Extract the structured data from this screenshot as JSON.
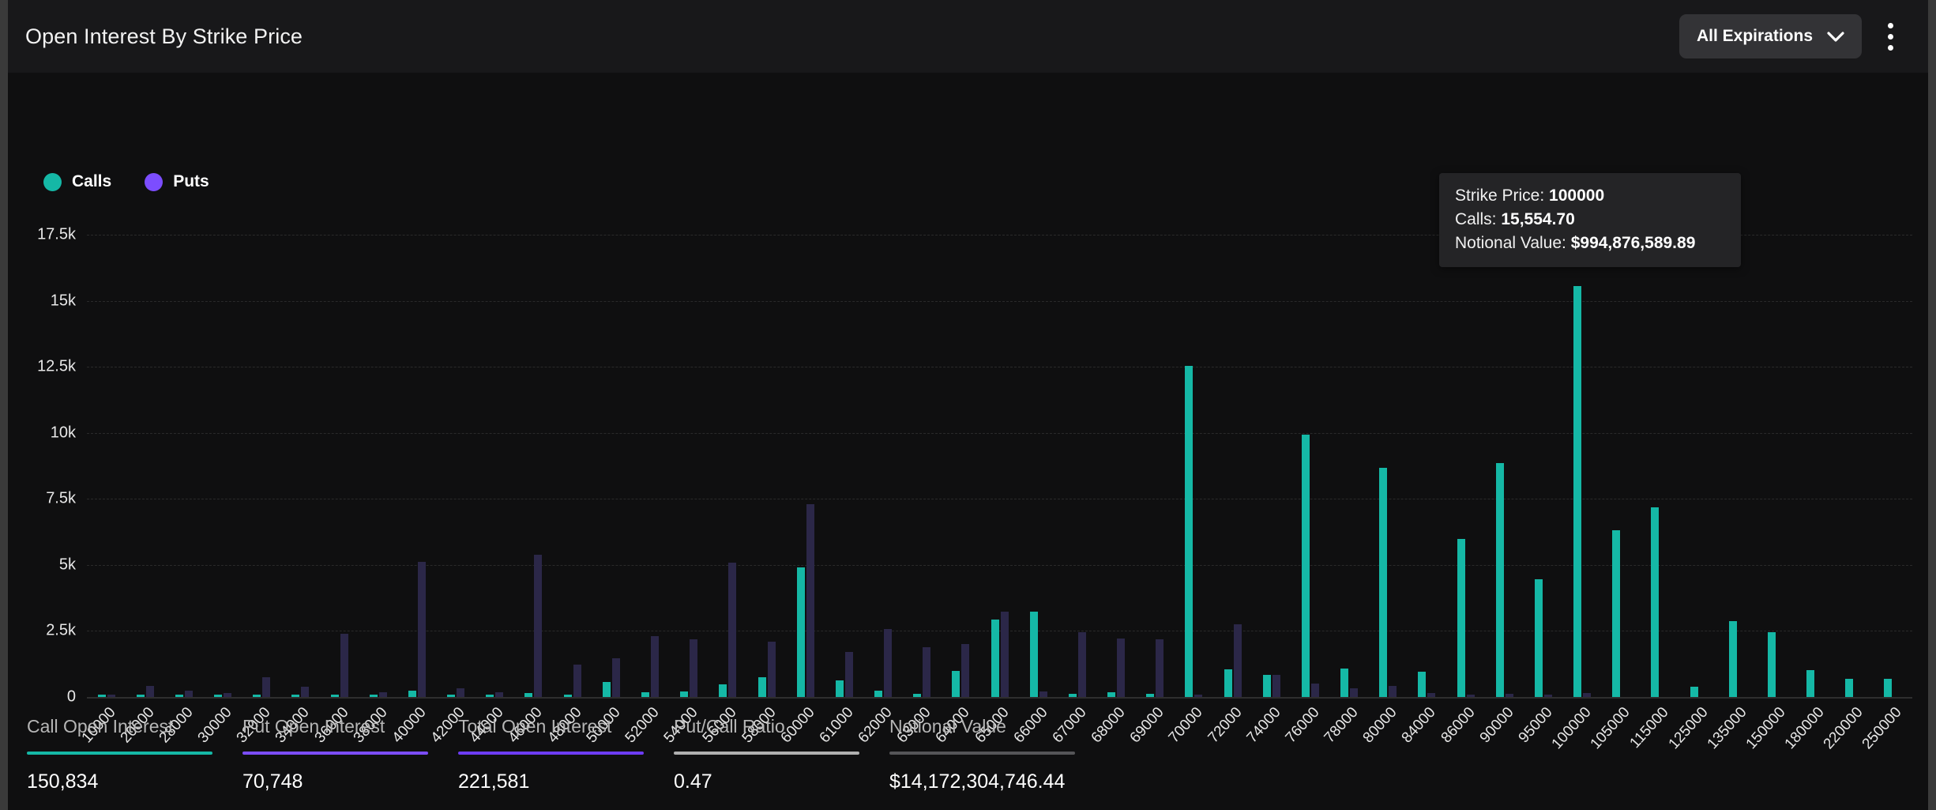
{
  "header": {
    "title": "Open Interest By Strike Price",
    "expirations_label": "All Expirations",
    "chevron_icon": "chevron-down-icon",
    "menu_icon": "kebab-menu-icon"
  },
  "legend": [
    {
      "label": "Calls",
      "color": "#15b8a6"
    },
    {
      "label": "Puts",
      "color": "#7c4dff"
    }
  ],
  "tooltip": {
    "strike_label": "Strike Price:",
    "strike_value": "100000",
    "calls_label": "Calls:",
    "calls_value": "15,554.70",
    "notional_label": "Notional Value:",
    "notional_value": "$994,876,589.89"
  },
  "stats": [
    {
      "label": "Call Open Interest",
      "value": "150,834",
      "color": "#15b8a6"
    },
    {
      "label": "Put Open Interest",
      "value": "70,748",
      "color": "#7c4dff"
    },
    {
      "label": "Total Open Interest",
      "value": "221,581",
      "color": "#6d3cf5"
    },
    {
      "label": "Put/Call Ratio",
      "value": "0.47",
      "color": "#b0b0b0"
    },
    {
      "label": "Notional Value",
      "value": "$14,172,304,746.44",
      "color": "#555558"
    }
  ],
  "chart_data": {
    "type": "bar",
    "title": "Open Interest By Strike Price",
    "xlabel": "",
    "ylabel": "",
    "ylim": [
      0,
      18400
    ],
    "grid": true,
    "legend_position": "top-left",
    "ytick_labels": [
      "17.5k",
      "15k",
      "12.5k",
      "10k",
      "7.5k",
      "5k",
      "2.5k",
      "0"
    ],
    "ytick_values": [
      17500,
      15000,
      12500,
      10000,
      7500,
      5000,
      2500,
      0
    ],
    "categories": [
      "10000",
      "20000",
      "28000",
      "30000",
      "32000",
      "34000",
      "36000",
      "38000",
      "40000",
      "42000",
      "44000",
      "46000",
      "48000",
      "50000",
      "52000",
      "54000",
      "56000",
      "58000",
      "60000",
      "61000",
      "62000",
      "63000",
      "64000",
      "65000",
      "66000",
      "67000",
      "68000",
      "69000",
      "70000",
      "72000",
      "74000",
      "76000",
      "78000",
      "80000",
      "84000",
      "86000",
      "90000",
      "95000",
      "100000",
      "105000",
      "115000",
      "125000",
      "135000",
      "150000",
      "180000",
      "220000",
      "250000"
    ],
    "series": [
      {
        "name": "Calls",
        "color": "#15b8a6",
        "values": [
          60,
          90,
          100,
          40,
          70,
          30,
          60,
          70,
          240,
          60,
          90,
          160,
          100,
          560,
          180,
          200,
          480,
          760,
          4920,
          640,
          250,
          120,
          990,
          2930,
          3220,
          110,
          180,
          120,
          12550,
          1060,
          830,
          9930,
          1090,
          8680,
          950,
          5980,
          8850,
          4460,
          15554,
          6310,
          7190,
          390,
          2880,
          2450,
          1010,
          700,
          690
        ]
      },
      {
        "name": "Puts",
        "color": "#7c4dff",
        "values": [
          30,
          420,
          250,
          160,
          760,
          380,
          2390,
          180,
          5110,
          320,
          190,
          5400,
          1240,
          1480,
          2310,
          2190,
          5090,
          2100,
          7290,
          1700,
          2570,
          1900,
          2010,
          3240,
          210,
          2440,
          2210,
          2180,
          80,
          2740,
          840,
          520,
          330,
          410,
          140,
          80,
          120,
          40,
          150,
          0,
          0,
          0,
          0,
          0,
          0,
          0,
          0
        ]
      }
    ],
    "highlight": {
      "category": "100000",
      "series": "Calls",
      "value": 15554.7
    }
  }
}
